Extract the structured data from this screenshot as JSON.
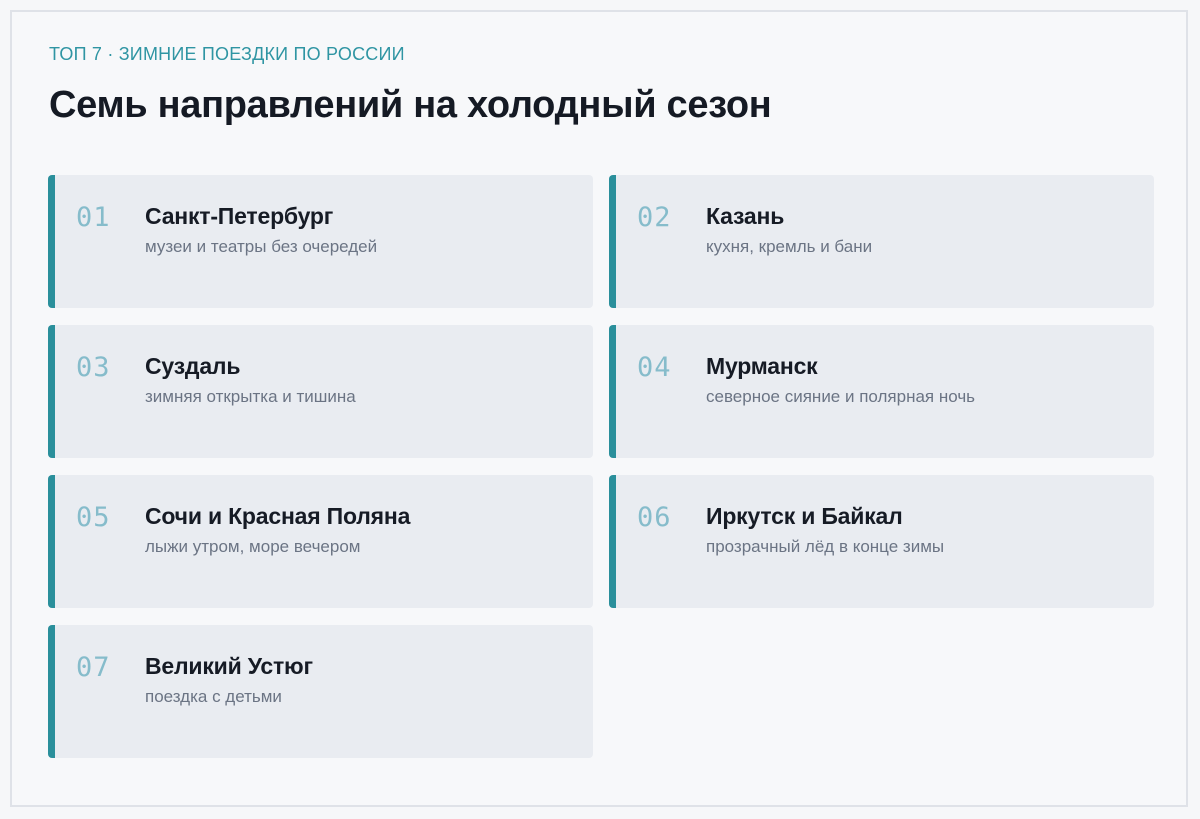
{
  "header": {
    "eyebrow": "ТОП 7 · ЗИМНИЕ ПОЕЗДКИ ПО РОССИИ",
    "title": "Семь направлений на холодный сезон"
  },
  "accent_color": "#2a8f9b",
  "destinations": [
    {
      "num": "01",
      "name": "Санкт-Петербург",
      "desc": "музеи и театры без очередей"
    },
    {
      "num": "02",
      "name": "Казань",
      "desc": "кухня, кремль и бани"
    },
    {
      "num": "03",
      "name": "Суздаль",
      "desc": "зимняя открытка и тишина"
    },
    {
      "num": "04",
      "name": "Мурманск",
      "desc": "северное сияние и полярная ночь"
    },
    {
      "num": "05",
      "name": "Сочи и Красная Поляна",
      "desc": "лыжи утром, море вечером"
    },
    {
      "num": "06",
      "name": "Иркутск и Байкал",
      "desc": "прозрачный лёд в конце зимы"
    },
    {
      "num": "07",
      "name": "Великий Устюг",
      "desc": "поездка с детьми"
    }
  ]
}
